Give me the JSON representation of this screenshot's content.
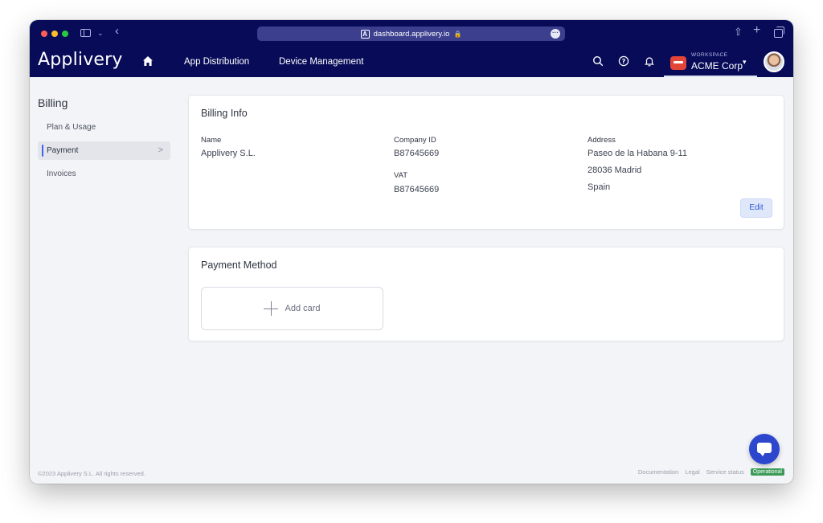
{
  "browser": {
    "url": "dashboard.applivery.io",
    "icons": [
      "sidebar-toggle-icon",
      "chevron-down-icon",
      "back-icon",
      "site-icon",
      "lock-icon",
      "page-menu-icon",
      "share-icon",
      "new-tab-icon",
      "tabs-overview-icon"
    ]
  },
  "header": {
    "brand": "Applivery",
    "nav": [
      {
        "label": "App Distribution"
      },
      {
        "label": "Device Management"
      }
    ],
    "workspace_caption": "WORKSPACE",
    "workspace_name": "ACME Corp",
    "icons": [
      "home-icon",
      "search-icon",
      "help-icon",
      "bell-icon",
      "chevron-down-icon",
      "avatar"
    ]
  },
  "sidebar": {
    "title": "Billing",
    "items": [
      {
        "label": "Plan & Usage",
        "active": false
      },
      {
        "label": "Payment",
        "active": true
      },
      {
        "label": "Invoices",
        "active": false
      }
    ]
  },
  "billing_info": {
    "title": "Billing Info",
    "name_label": "Name",
    "name_value": "Applivery S.L.",
    "company_id_label": "Company ID",
    "company_id_value": "B87645669",
    "vat_label": "VAT",
    "vat_value": "B87645669",
    "address_label": "Address",
    "address_line1": "Paseo de la Habana 9-11",
    "address_line2": "28036 Madrid",
    "address_line3": "Spain",
    "edit_label": "Edit"
  },
  "payment_method": {
    "title": "Payment Method",
    "add_card_label": "Add card"
  },
  "footer": {
    "copyright": "©2023 Applivery S.L. All rights reserved.",
    "documentation": "Documentation",
    "legal": "Legal",
    "service_status": "Service status",
    "status_badge": "Operational"
  },
  "colors": {
    "header_bg": "#070b58",
    "accent": "#3c63f2",
    "status_ok": "#3a9a56",
    "chat_button": "#2c46ce",
    "workspace_logo": "#e34637"
  }
}
